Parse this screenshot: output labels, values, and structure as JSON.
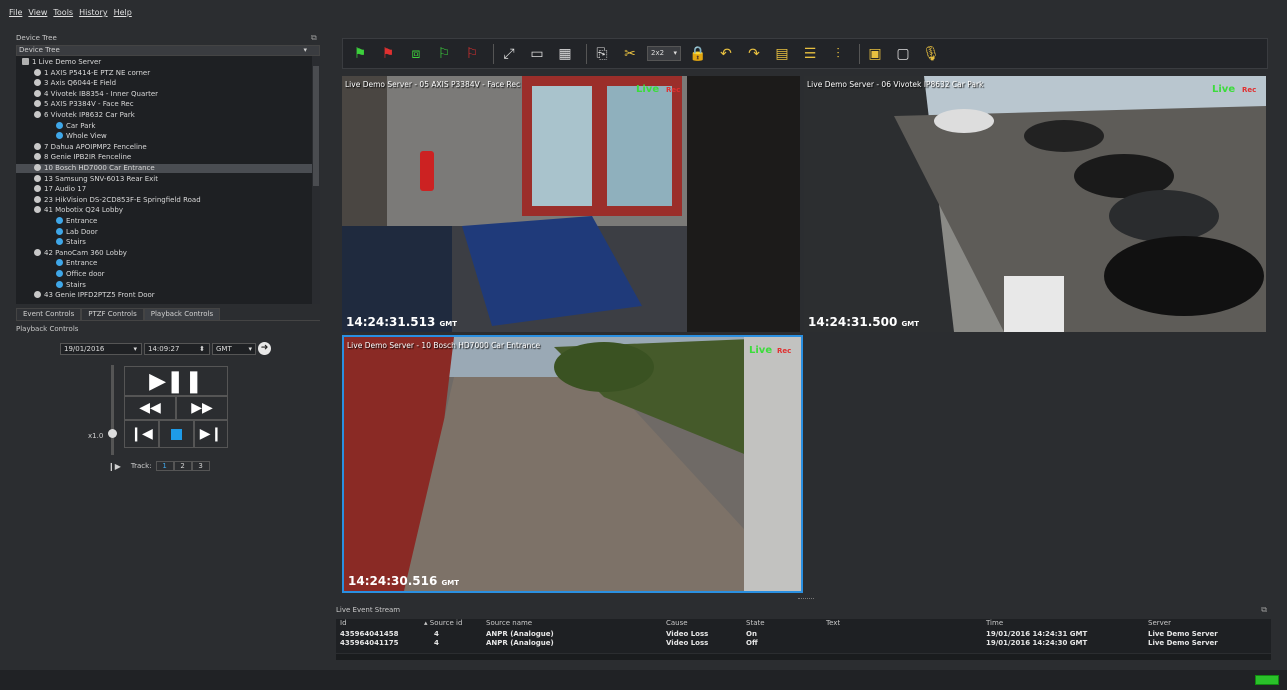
{
  "menu": [
    "File",
    "View",
    "Tools",
    "History",
    "Help"
  ],
  "device_tree": {
    "panel_title": "Device Tree",
    "selector_value": "Device Tree",
    "nodes": [
      {
        "label": "1 Live Demo Server",
        "type": "server",
        "level": 0
      },
      {
        "label": "1 AXIS P5414-E PTZ NE corner",
        "type": "cam",
        "level": 1
      },
      {
        "label": "3 Axis Q6044-E Field",
        "type": "cam",
        "level": 1
      },
      {
        "label": "4 Vivotek IB8354 - Inner Quarter",
        "type": "cam",
        "level": 1
      },
      {
        "label": "5 AXIS P3384V - Face Rec",
        "type": "cam",
        "level": 1
      },
      {
        "label": "6 Vivotek IP8632 Car Park",
        "type": "cam",
        "level": 1
      },
      {
        "label": "Car Park",
        "type": "view",
        "level": 2
      },
      {
        "label": "Whole View",
        "type": "view",
        "level": 2
      },
      {
        "label": "7 Dahua APOIPMP2 Fenceline",
        "type": "cam",
        "level": 1
      },
      {
        "label": "8 Genie IPB2IR Fenceline",
        "type": "cam",
        "level": 1
      },
      {
        "label": "10 Bosch HD7000 Car Entrance",
        "type": "cam",
        "level": 1,
        "selected": true
      },
      {
        "label": "13 Samsung SNV-6013 Rear Exit",
        "type": "cam",
        "level": 1
      },
      {
        "label": "17 Audio 17",
        "type": "cam",
        "level": 1
      },
      {
        "label": "23 HikVision DS-2CD853F-E Springfield Road",
        "type": "cam",
        "level": 1
      },
      {
        "label": "41 Mobotix Q24 Lobby",
        "type": "cam",
        "level": 1
      },
      {
        "label": "Entrance",
        "type": "view",
        "level": 2
      },
      {
        "label": "Lab Door",
        "type": "view",
        "level": 2
      },
      {
        "label": "Stairs",
        "type": "view",
        "level": 2
      },
      {
        "label": "42 PanoCam 360 Lobby",
        "type": "cam",
        "level": 1
      },
      {
        "label": "Entrance",
        "type": "view",
        "level": 2
      },
      {
        "label": "Office door",
        "type": "view",
        "level": 2
      },
      {
        "label": "Stairs",
        "type": "view",
        "level": 2
      },
      {
        "label": "43 Genie IPFD2PTZ5 Front Door",
        "type": "cam",
        "level": 1
      }
    ]
  },
  "tabs": [
    "Event Controls",
    "PTZF Controls",
    "Playback Controls"
  ],
  "playback": {
    "panel_title": "Playback Controls",
    "date": "19/01/2016",
    "time": "14:09:27",
    "timezone": "GMT",
    "speed": "x1.0",
    "speed_level": 0.5,
    "track_label": "Track:",
    "tracks": [
      "1",
      "2",
      "3"
    ]
  },
  "toolbar": {
    "grid_value": "2x2"
  },
  "tiles": [
    {
      "title": "Live Demo Server - 05 AXIS P3384V - Face Rec",
      "live": "Live",
      "rec": "Rec",
      "time": "14:24:31.513",
      "tz": "GMT"
    },
    {
      "title": "Live Demo Server - 06 Vivotek IP8632 Car Park",
      "live": "Live",
      "rec": "Rec",
      "time": "14:24:31.500",
      "tz": "GMT"
    },
    {
      "title": "Live Demo Server - 10 Bosch HD7000 Car Entrance",
      "live": "Live",
      "rec": "Rec",
      "time": "14:24:30.516",
      "tz": "GMT"
    }
  ],
  "events": {
    "title": "Live Event Stream",
    "columns": [
      "Id",
      "Source id",
      "Source name",
      "Cause",
      "State",
      "Text",
      "Time",
      "Server"
    ],
    "rows": [
      [
        "435964041458",
        "4",
        "ANPR (Analogue)",
        "Video Loss",
        "On",
        "",
        "19/01/2016 14:24:31 GMT",
        "Live Demo Server"
      ],
      [
        "435964041175",
        "4",
        "ANPR (Analogue)",
        "Video Loss",
        "Off",
        "",
        "19/01/2016 14:24:30 GMT",
        "Live Demo Server"
      ]
    ]
  },
  "colors": {
    "live": "#3cdc3c",
    "rec": "#e03030",
    "selected_tile_border": "#2a8fe0",
    "status_ok": "#2ac02a"
  }
}
